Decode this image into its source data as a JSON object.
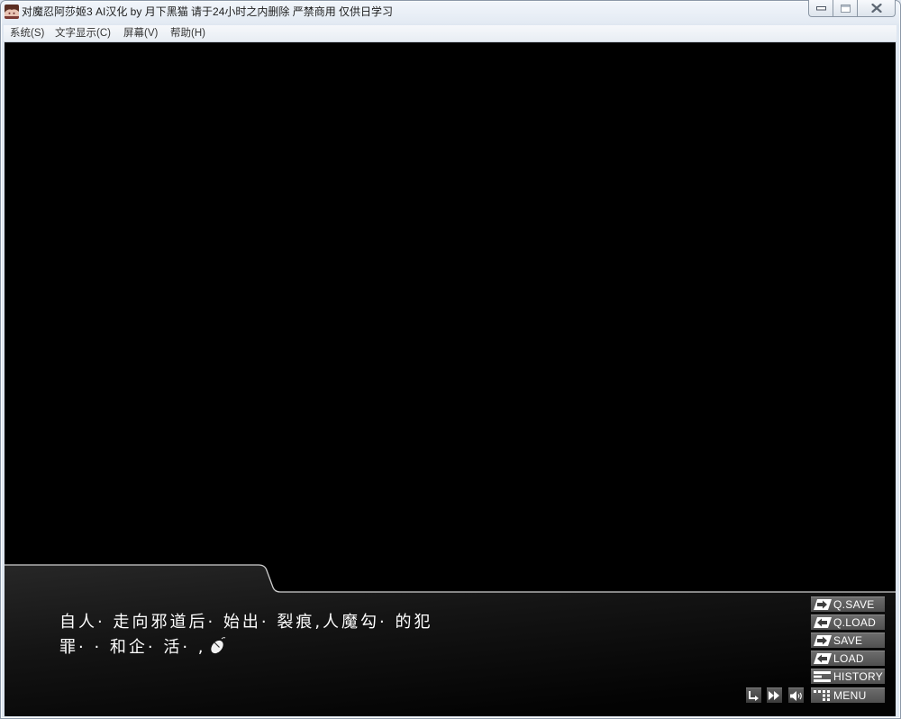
{
  "window": {
    "title": "对魔忍阿莎姬3 AI汉化 by 月下黑猫 请于24小时之内删除 严禁商用 仅供日学习",
    "app_icon": "app-icon",
    "controls": [
      {
        "icon": "minimize-icon"
      },
      {
        "icon": "maximize-icon"
      },
      {
        "icon": "close-icon"
      }
    ]
  },
  "menu_bar": {
    "items": [
      {
        "label": "系统(S)"
      },
      {
        "label": "文字显示(C)"
      },
      {
        "label": "屏幕(V)"
      },
      {
        "label": "帮助(H)"
      }
    ]
  },
  "dialog": {
    "lines": [
      "自人· 走向邪道后· 始出· 裂痕,人魔勾· 的犯",
      "罪· · 和企· 活· ,"
    ],
    "wait_icon": "mouse-wait-icon"
  },
  "side_buttons": [
    {
      "label": "Q.SAVE",
      "icon": "save-arrow-icon"
    },
    {
      "label": "Q.LOAD",
      "icon": "load-arrow-icon"
    },
    {
      "label": "SAVE",
      "icon": "save-arrow-icon"
    },
    {
      "label": "LOAD",
      "icon": "load-arrow-icon"
    },
    {
      "label": "HISTORY",
      "icon": "history-icon"
    },
    {
      "label": "MENU",
      "icon": "menu-grid-icon"
    }
  ],
  "quick_controls": [
    {
      "icon": "skip-icon"
    },
    {
      "icon": "fast-forward-icon"
    },
    {
      "icon": "voice-icon"
    }
  ],
  "colors": {
    "frame": "#dfe7f1",
    "game_background": "#000000",
    "dialog_text": "#ffffff",
    "button_background": "#505050",
    "button_text": "#ffffff"
  }
}
